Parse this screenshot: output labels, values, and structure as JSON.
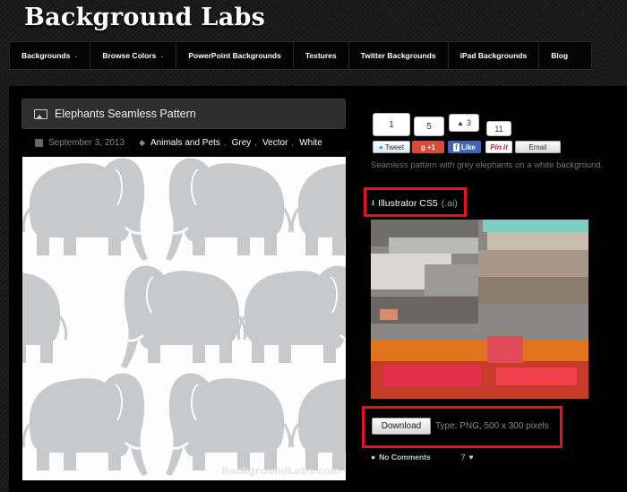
{
  "site": {
    "title": "Background Labs"
  },
  "nav": {
    "items": [
      {
        "label": "Backgrounds",
        "caret": "⌄"
      },
      {
        "label": "Browse Colors",
        "caret": "⌄"
      },
      {
        "label": "PowerPoint Backgrounds"
      },
      {
        "label": "Textures"
      },
      {
        "label": "Twitter Backgrounds"
      },
      {
        "label": "iPad Backgrounds"
      },
      {
        "label": "Blog"
      }
    ]
  },
  "post": {
    "title": "Elephants Seamless Pattern",
    "date": "September 3, 2013",
    "categories": [
      "Animals and Pets",
      "Grey",
      "Vector",
      "White"
    ],
    "watermark": "BackgroundLabs.com",
    "pattern_colors": {
      "background": "#fdfdfd",
      "elephant": "#c7c9cb"
    },
    "description": "Seamless pattern with grey elephants on a white background.",
    "illustrator_link": {
      "label": "Illustrator CS5",
      "ext": "(.ai)"
    },
    "download": {
      "button_label": "Download",
      "type_text": "Type: PNG, 500 x 300 pixels"
    },
    "comments": "No Comments",
    "likes": "7"
  },
  "share": {
    "tweet": {
      "count": "1",
      "label": "Tweet"
    },
    "gplus": {
      "count": "5",
      "label": "+1"
    },
    "fblike": {
      "count": "3",
      "label": "Like"
    },
    "pinit": {
      "count": "11",
      "label": "Pin it"
    },
    "email": {
      "label": "Email"
    }
  },
  "colors": {
    "highlight": "#e8121e",
    "accent": "#ffffff"
  }
}
